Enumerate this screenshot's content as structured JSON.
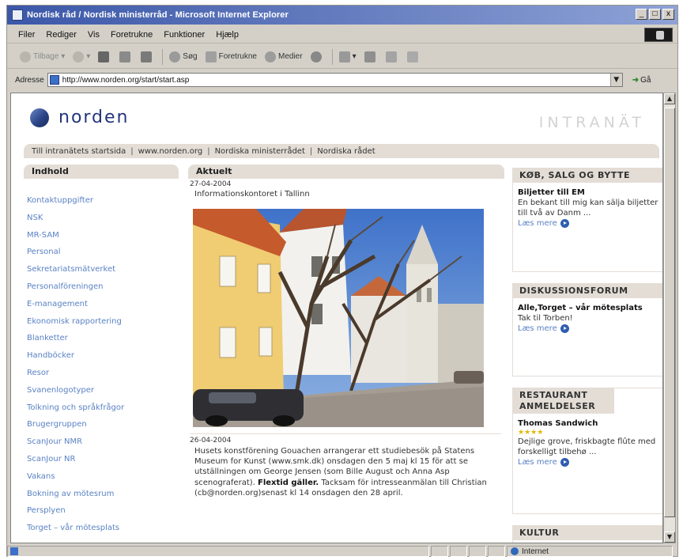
{
  "window": {
    "title": "Nordisk råd / Nordisk ministerråd - Microsoft Internet Explorer",
    "buttons": [
      "_",
      "□",
      "x"
    ]
  },
  "menu": [
    "Filer",
    "Rediger",
    "Vis",
    "Foretrukne",
    "Funktioner",
    "Hjælp"
  ],
  "toolbar": {
    "back": "Tilbage",
    "search": "Søg",
    "favorites": "Foretrukne",
    "media": "Medier"
  },
  "address": {
    "label": "Adresse",
    "url": "http://www.norden.org/start/start.asp",
    "go": "Gå"
  },
  "page": {
    "logo_text": "norden",
    "intranat": "INTRANÄT",
    "nav": [
      "Till intranätets startsida",
      "www.norden.org",
      "Nordiska ministerrådet",
      "Nordiska rådet"
    ],
    "nav_separator": "|",
    "left_heading": "Indhold",
    "sidebar_items": [
      "Kontaktuppgifter",
      "NSK",
      "MR-SAM",
      "Personal",
      "Sekretariatsmätverket",
      "Personalföreningen",
      "E-management",
      "Ekonomisk rapportering",
      "Blanketter",
      "Handböcker",
      "Resor",
      "Svanenlogotyper",
      "Tolkning och språkfrågor",
      "Brugergruppen",
      "ScanJour NMR",
      "ScanJour NR",
      "Vakans",
      "Bokning av mötesrum",
      "Persplyen",
      "Torget – vår mötesplats"
    ],
    "center_heading": "Aktuelt",
    "news": [
      {
        "date": "27-04-2004",
        "headline": "Informationskontoret i Tallinn"
      },
      {
        "date": "26-04-2004",
        "body_before": "Husets konstförening Gouachen arrangerar ett studiebesök på Statens Museum for Kunst (www.smk.dk) onsdagen den 5 maj kl 15 för att se utställningen om George Jensen (som Bille August och Anna Asp scenograferat). ",
        "body_bold": "Flextid gäller.",
        "body_after": " Tacksam för intresseanmälan till Christian (cb@norden.org)senast kl 14 onsdagen den 28 april."
      }
    ],
    "boxes": [
      {
        "head": "KØB, SALG OG BYTTE",
        "title": "Biljetter till EM",
        "text": "En bekant till mig kan sälja biljetter till två av Danm ...",
        "more": "Læs mere"
      },
      {
        "head": "DISKUSSIONSFORUM",
        "title": "Alle,Torget – vår mötesplats",
        "text": "Tak til Torben!",
        "more": "Læs mere"
      },
      {
        "head": "RESTAURANT ANMELDELSER",
        "title": "Thomas Sandwich",
        "stars": "★★★★",
        "text": "Dejlige grove, friskbagte flûte med forskelligt tilbehø ...",
        "more": "Læs mere"
      },
      {
        "head": "KULTUR"
      }
    ]
  },
  "status": {
    "zone": "Internet"
  }
}
